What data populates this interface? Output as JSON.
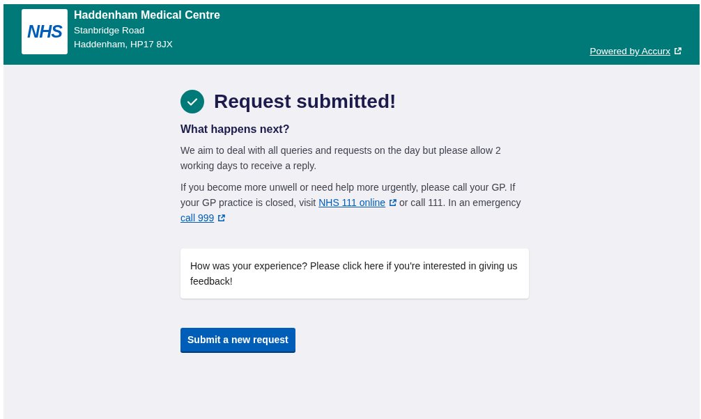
{
  "header": {
    "logo": "NHS",
    "practice_name": "Haddenham Medical Centre",
    "address_lines": [
      "Stanbridge Road",
      "Haddenham, HP17 8JX"
    ],
    "powered_by_link": "Powered by Accurx"
  },
  "title": "Request submitted!",
  "subtitle": "What happens next?",
  "paragraphs": [
    [
      {
        "kind": "text",
        "text": "We aim to deal with all queries and requests on the day but please allow 2 working days to receive a reply."
      }
    ],
    [
      {
        "kind": "text",
        "text": "If you become more unwell or need help more urgently, please call your GP. If your GP practice is closed, visit "
      },
      {
        "kind": "link",
        "text": "NHS 111 online"
      },
      {
        "kind": "text",
        "text": " or call 111. In an emergency "
      },
      {
        "kind": "link",
        "text": "call 999"
      }
    ]
  ],
  "feedback_card": "How was your experience? Please click here if you're interested in giving us feedback!",
  "button": "Submit a new request"
}
